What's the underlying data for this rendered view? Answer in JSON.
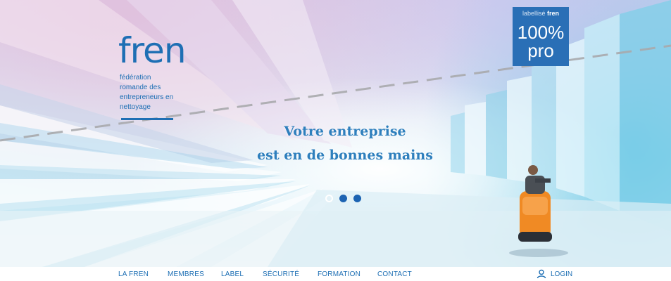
{
  "logo": {
    "wordmark": "fren",
    "tagline": [
      "fédération",
      "romande des",
      "entrepreneurs en",
      "nettoyage"
    ]
  },
  "badge": {
    "prefix": "labellisé",
    "brand": "fren",
    "percent": "100%",
    "word": "pro"
  },
  "hero": {
    "headline_line1": "Votre entreprise",
    "headline_line2": "est en de bonnes mains",
    "slides_total": 3,
    "active_slide": 1
  },
  "nav": {
    "items": [
      "LA FREN",
      "MEMBRES",
      "LABEL",
      "SÉCURITÉ",
      "FORMATION",
      "CONTACT"
    ],
    "login_label": "LOGIN",
    "login_icon": "user-icon"
  },
  "colors": {
    "brand_blue": "#1e6fb4",
    "badge_blue": "#2a6fb6",
    "headline_blue": "#2e7fbd",
    "dot_active": "#1c63b2"
  }
}
